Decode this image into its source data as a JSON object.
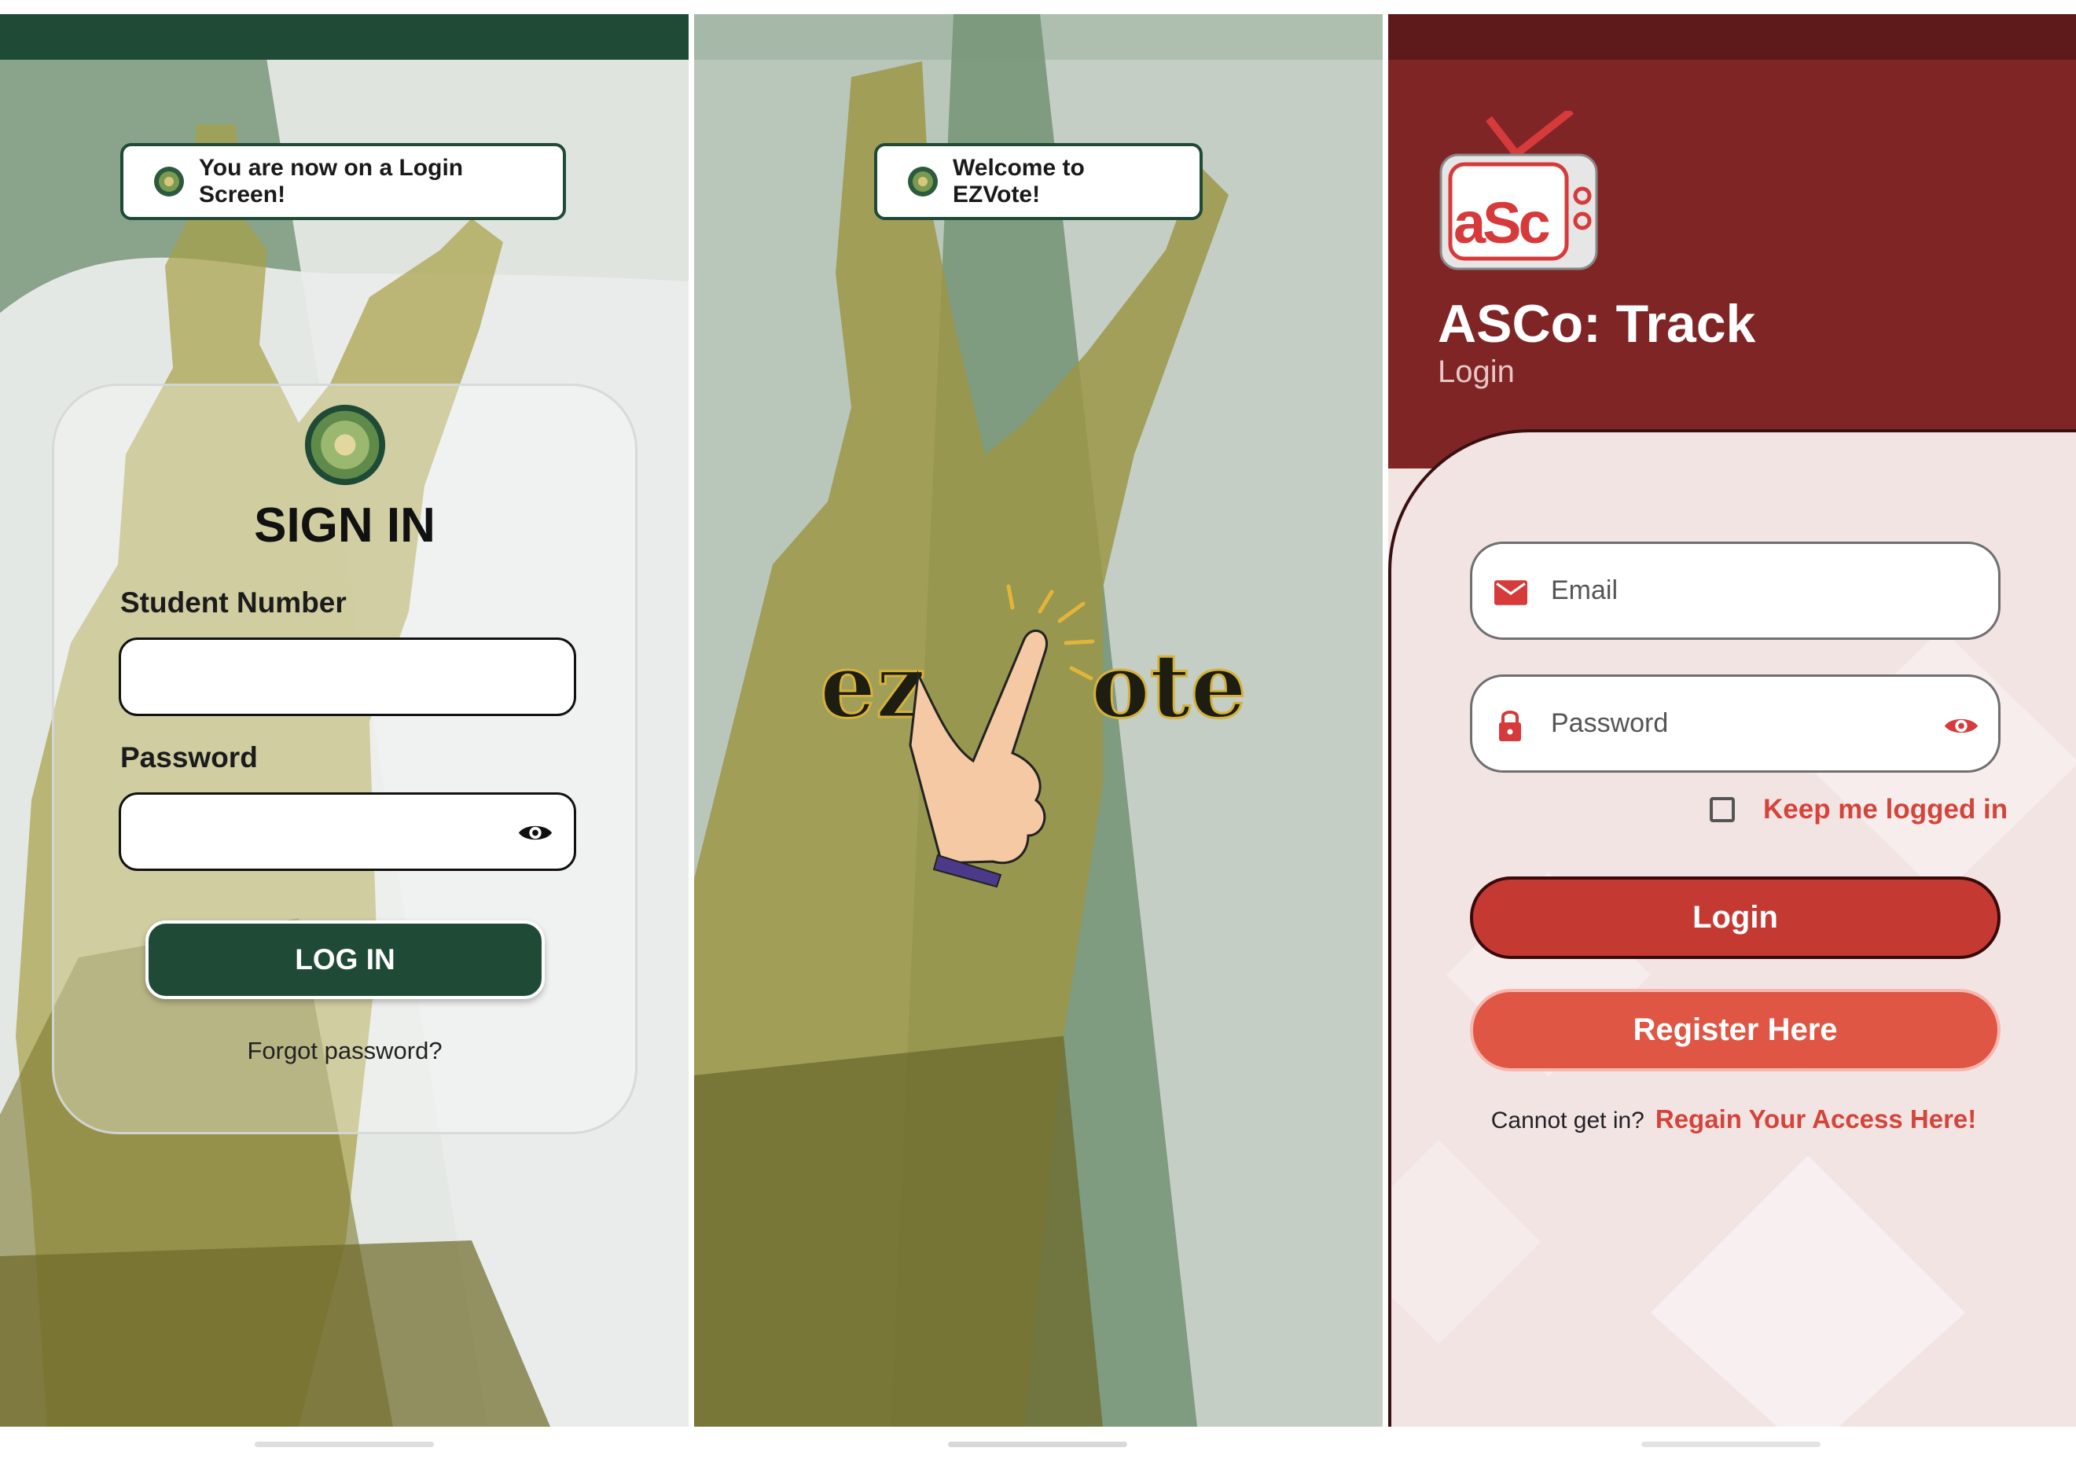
{
  "ezvote_login": {
    "toast": "You are now on a Login Screen!",
    "title": "SIGN IN",
    "student_number_label": "Student Number",
    "student_number_value": "",
    "password_label": "Password",
    "password_value": "",
    "login_button": "LOG IN",
    "forgot_link": "Forgot password?",
    "status_bar_color": "#1e4a36"
  },
  "ezvote_splash": {
    "toast": "Welcome to EZVote!",
    "logo_text_left": "ez",
    "logo_text_right": "ote"
  },
  "asco": {
    "app_title": "ASCo: Track",
    "subtitle": "Login",
    "logo_text": "aSc",
    "email_placeholder": "Email",
    "password_placeholder": "Password",
    "keep_logged_in": "Keep me logged in",
    "login_button": "Login",
    "register_button": "Register Here",
    "cannot_get_in": "Cannot get in?",
    "regain_link": "Regain Your Access Here!",
    "header_color": "#7f2525",
    "accent_color": "#d5443a"
  },
  "icons": [
    "seal-icon",
    "eye-icon",
    "email-icon",
    "lock-icon",
    "checkmark-icon"
  ]
}
